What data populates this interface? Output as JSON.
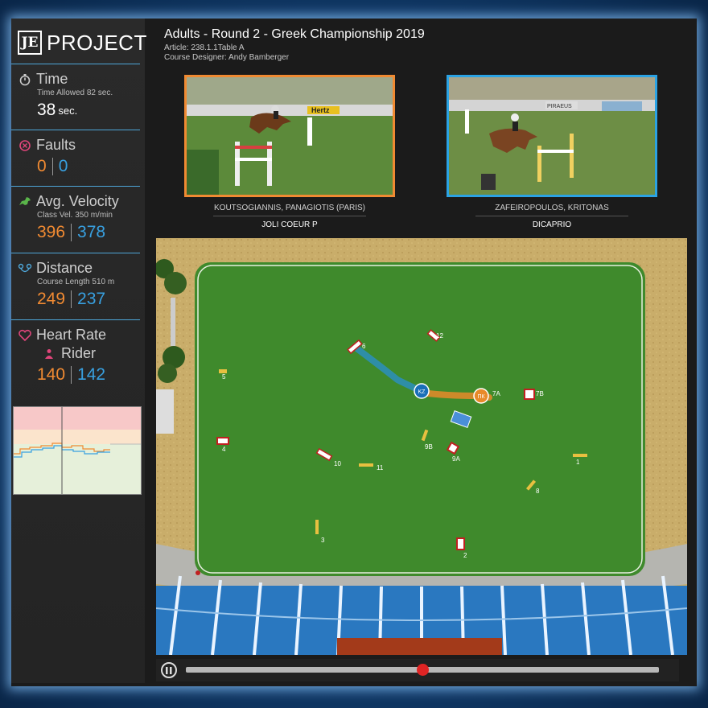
{
  "logo": {
    "mark": "JE",
    "text": "PROJECT"
  },
  "stats": {
    "time": {
      "label": "Time",
      "sub": "Time Allowed 82 sec.",
      "value": "38",
      "unit": "sec."
    },
    "faults": {
      "label": "Faults",
      "a": "0",
      "b": "0"
    },
    "velocity": {
      "label": "Avg. Velocity",
      "sub": "Class Vel. 350 m/min",
      "a": "396",
      "b": "378"
    },
    "distance": {
      "label": "Distance",
      "sub": "Course Length 510 m",
      "a": "249",
      "b": "237"
    },
    "heart": {
      "label": "Heart Rate",
      "sublabel": "Rider",
      "a": "140",
      "b": "142"
    }
  },
  "header": {
    "title": "Adults - Round 2 - Greek Championship 2019",
    "article": "Article: 238.1.1Table A",
    "designer": "Course Designer: Andy Bamberger"
  },
  "competitors": [
    {
      "rider": "KOUTSOGIANNIS, PANAGIOTIS (PARIS)",
      "horse": "JOLI COEUR P",
      "color": "#f08a32"
    },
    {
      "rider": "ZAFEIROPOULOS, KRITONAS",
      "horse": "DICAPRIO",
      "color": "#2ba3e4"
    }
  ],
  "markers": {
    "blue": "KZ",
    "orange": "ПК"
  },
  "obstacles": [
    "1",
    "2",
    "3",
    "4",
    "5",
    "6",
    "7A",
    "7B",
    "8",
    "9A",
    "9B",
    "10",
    "11",
    "12"
  ],
  "video_ads": {
    "left": "Hertz",
    "right": "PIRAEUS"
  },
  "colors": {
    "accent_orange": "#f08a32",
    "accent_blue": "#2ba3e4",
    "field": "#3f8a2c"
  },
  "playback": {
    "progress": 0.5
  }
}
